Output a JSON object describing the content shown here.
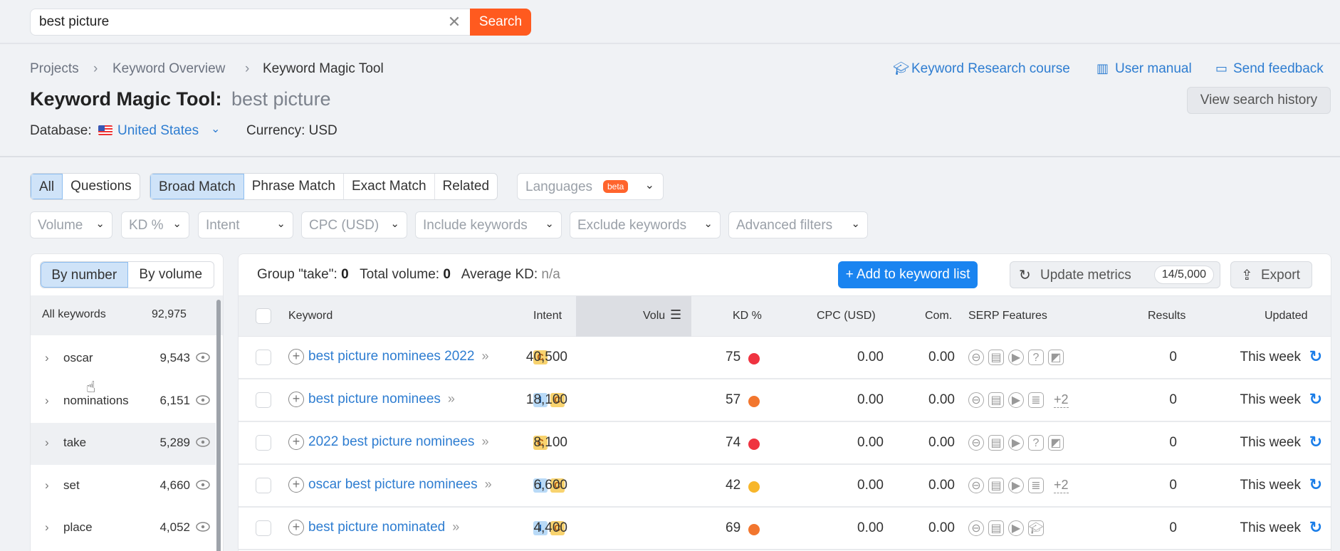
{
  "search": {
    "value": "best picture",
    "clear_icon": "close-icon",
    "button_label": "Search"
  },
  "breadcrumb": [
    "Projects",
    "Keyword Overview",
    "Keyword Magic Tool"
  ],
  "header": {
    "title": "Keyword Magic Tool:",
    "query": "best picture",
    "database_label": "Database:",
    "database_value": "United States",
    "currency": "Currency: USD",
    "links": [
      {
        "icon": "graduation-cap-icon",
        "label": "Keyword Research course"
      },
      {
        "icon": "book-icon",
        "label": "User manual"
      },
      {
        "icon": "feedback-icon",
        "label": "Send feedback"
      }
    ],
    "history_button": "View search history"
  },
  "filters": {
    "type_tabs": [
      {
        "label": "All",
        "active": true
      },
      {
        "label": "Questions",
        "active": false
      }
    ],
    "match_tabs": [
      {
        "label": "Broad Match",
        "active": true
      },
      {
        "label": "Phrase Match",
        "active": false
      },
      {
        "label": "Exact Match",
        "active": false
      },
      {
        "label": "Related",
        "active": false
      }
    ],
    "languages": {
      "label": "Languages",
      "badge": "beta"
    },
    "dropdowns": [
      "Volume",
      "KD %",
      "Intent",
      "CPC (USD)",
      "Include keywords",
      "Exclude keywords",
      "Advanced filters"
    ]
  },
  "sidebar": {
    "sort_tabs": [
      {
        "label": "By number",
        "active": true
      },
      {
        "label": "By volume",
        "active": false
      }
    ],
    "all_keywords": {
      "label": "All keywords",
      "count": "92,975"
    },
    "groups": [
      {
        "name": "oscar",
        "count": "9,543"
      },
      {
        "name": "nominations",
        "count": "6,151"
      },
      {
        "name": "take",
        "count": "5,289",
        "hovered": true
      },
      {
        "name": "set",
        "count": "4,660"
      },
      {
        "name": "place",
        "count": "4,052"
      }
    ]
  },
  "summary": {
    "group_label": "Group \"take\":",
    "group_value": "0",
    "volume_label": "Total volume:",
    "volume_value": "0",
    "kd_label": "Average KD:",
    "kd_value": "n/a"
  },
  "actions": {
    "add_label": "+  Add to keyword list",
    "update_label": "Update metrics",
    "update_count": "14/5,000",
    "export_label": "Export"
  },
  "table": {
    "columns": [
      "Keyword",
      "Intent",
      "Volu",
      "KD %",
      "CPC (USD)",
      "Com.",
      "SERP Features",
      "Results",
      "Updated"
    ],
    "sorted_column": "Volume",
    "rows": [
      {
        "keyword": "best picture nominees 2022",
        "intents": [
          "C"
        ],
        "volume": "40,500",
        "kd": "75",
        "kd_color": "#ef3340",
        "cpc": "0.00",
        "com": "0.00",
        "serp": [
          "link-icon",
          "knowledge-panel-icon",
          "video-icon",
          "faq-icon",
          "image-pack-icon"
        ],
        "serp_more": "",
        "results": "0",
        "updated": "This week"
      },
      {
        "keyword": "best picture nominees",
        "intents": [
          "I",
          "C"
        ],
        "volume": "18,100",
        "kd": "57",
        "kd_color": "#f2762e",
        "cpc": "0.00",
        "com": "0.00",
        "serp": [
          "link-icon",
          "knowledge-panel-icon",
          "video-icon",
          "news-icon"
        ],
        "serp_more": "+2",
        "results": "0",
        "updated": "This week"
      },
      {
        "keyword": "2022 best picture nominees",
        "intents": [
          "C"
        ],
        "volume": "8,100",
        "kd": "74",
        "kd_color": "#ef3340",
        "cpc": "0.00",
        "com": "0.00",
        "serp": [
          "link-icon",
          "knowledge-panel-icon",
          "video-icon",
          "faq-icon",
          "image-pack-icon"
        ],
        "serp_more": "",
        "results": "0",
        "updated": "This week"
      },
      {
        "keyword": "oscar best picture nominees",
        "intents": [
          "I",
          "C"
        ],
        "volume": "6,600",
        "kd": "42",
        "kd_color": "#f7b62b",
        "cpc": "0.00",
        "com": "0.00",
        "serp": [
          "link-icon",
          "knowledge-panel-icon",
          "video-icon",
          "news-icon"
        ],
        "serp_more": "+2",
        "results": "0",
        "updated": "This week"
      },
      {
        "keyword": "best picture nominated",
        "intents": [
          "I",
          "C"
        ],
        "volume": "4,400",
        "kd": "69",
        "kd_color": "#f2762e",
        "cpc": "0.00",
        "com": "0.00",
        "serp": [
          "link-icon",
          "knowledge-panel-icon",
          "video-icon",
          "graduation-cap-icon"
        ],
        "serp_more": "",
        "results": "0",
        "updated": "This week"
      }
    ]
  },
  "colors": {
    "search_button": "#ff5a1f",
    "link_blue": "#2e7dd1",
    "primary_button": "#1a84f0",
    "active_tab": "#cfe3f8"
  }
}
